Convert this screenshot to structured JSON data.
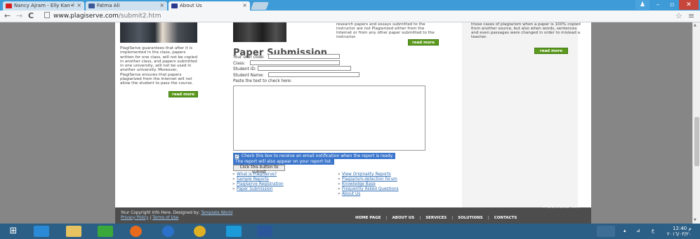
{
  "browser": {
    "tabs": [
      {
        "title": "Nancy Ajram - Elly Kan",
        "audio": "◂)"
      },
      {
        "title": "Fatma Ali"
      },
      {
        "title": "About Us"
      }
    ],
    "url_host": "www.plagiserve.com",
    "url_path": "/submit2.htm"
  },
  "page": {
    "left_text": "PlagiServe guarantees that after it is implemented in the class, papers written for one class, will not be copied in another class, and papers submitted in one university, will not be used in another university. Moreover, PlagiServe ensures that papers plagiarized from the Internet will not allow the student to pass the course.",
    "read_more": "read more",
    "mid_intro": "research papers and essays submitted to the instructor are not Plagiarized either from the Internet or from any other paper submitted to the instructor.",
    "right_text": "those cases of plagiarism when a paper is 100% copied from another source, but also when words, sentences and even passages were changed in order to mislead a teacher.",
    "form": {
      "title": "Paper Submission",
      "user_code_label": "Your user code:",
      "class_label": "Class:",
      "student_id_label": "Student ID:",
      "student_name_label": "Student Name:",
      "paste_label": "Paste the text to check here:",
      "notify_label": "Check this box to receive an email notification when the report is ready.",
      "notice_text": "The report will also appear on your report list.",
      "submit_label": "Click this button to submit"
    },
    "links_left": [
      "What is PlagiServe?",
      "Sample Reports",
      "Plagiserve Registration",
      "Paper Submission"
    ],
    "links_right": [
      "View Originality Reports",
      "Plagiarism-detection forum",
      "Knowledge Base",
      "Frequently Asked Questions",
      "About Us"
    ],
    "footer": {
      "copyright": "Your Copyright Info Here. Designed by:",
      "designer": "Template World",
      "privacy": "Privacy Policy",
      "terms": "Terms of Use",
      "nav": [
        "HOME PAGE",
        "ABOUT US",
        "SERVICES",
        "SOLUTIONS",
        "CONTACTS"
      ]
    },
    "watermark": "Activate Wi"
  },
  "taskbar": {
    "time": "12:40 م",
    "date": "٢٠١٦/٠٣/٢٠"
  },
  "colors": {
    "tabstrip": "#3e9bd8",
    "readmore": "#5c9a1e",
    "selection": "#3b76cc",
    "footer": "#4d4d4d",
    "taskbar": "#2c5f86"
  }
}
